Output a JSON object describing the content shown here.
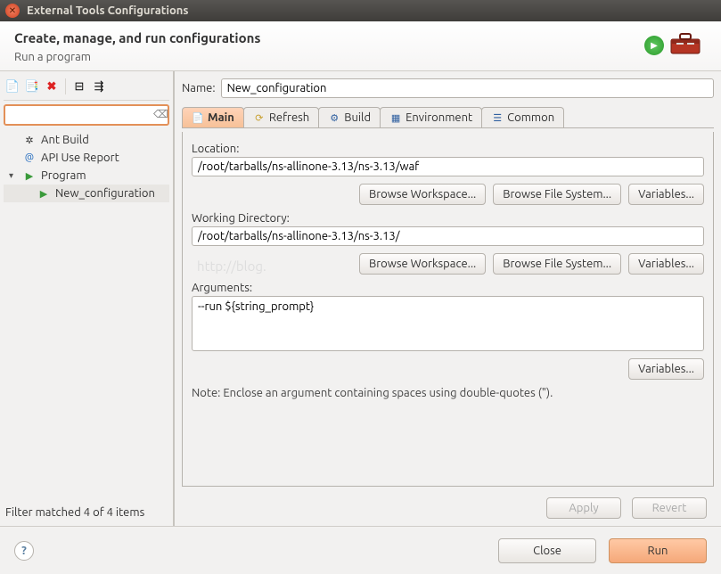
{
  "window": {
    "title": "External Tools Configurations"
  },
  "header": {
    "title": "Create, manage, and run configurations",
    "subtitle": "Run a program"
  },
  "sidebar": {
    "tree": {
      "ant": "Ant Build",
      "api": "API Use Report",
      "program": "Program",
      "child": "New_configuration"
    },
    "status": "Filter matched 4 of 4 items"
  },
  "name": {
    "label": "Name:",
    "value": "New_configuration"
  },
  "tabs": {
    "main": "Main",
    "refresh": "Refresh",
    "build": "Build",
    "environment": "Environment",
    "common": "Common"
  },
  "mainTab": {
    "location_label": "Location:",
    "location_value": "/root/tarballs/ns-allinone-3.13/ns-3.13/waf",
    "wd_label": "Working Directory:",
    "wd_value": "/root/tarballs/ns-allinone-3.13/ns-3.13/",
    "args_label": "Arguments:",
    "args_value": "--run ${string_prompt}",
    "btn_workspace": "Browse Workspace...",
    "btn_filesystem": "Browse File System...",
    "btn_variables": "Variables...",
    "note": "Note: Enclose an argument containing spaces using double-quotes (\")."
  },
  "actions": {
    "apply": "Apply",
    "revert": "Revert"
  },
  "bottom": {
    "close": "Close",
    "run": "Run"
  }
}
